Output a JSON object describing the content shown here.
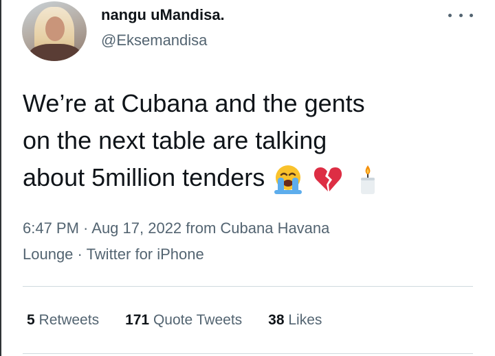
{
  "author": {
    "display_name": "nangu uMandisa.",
    "handle": "@Eksemandisa"
  },
  "tweet": {
    "lines": [
      "We’re at Cubana and the gents",
      "on the next table are talking",
      "about 5million tenders"
    ],
    "emojis": [
      "loudly-crying-face-emoji",
      "broken-heart-emoji",
      "candle-emoji"
    ]
  },
  "meta": {
    "line1": "6:47 PM · Aug 17, 2022 from Cubana Havana",
    "line2": "Lounge · Twitter for iPhone"
  },
  "stats": {
    "retweets_count": "5",
    "retweets_label": "Retweets",
    "quotes_count": "171",
    "quotes_label": "Quote Tweets",
    "likes_count": "38",
    "likes_label": "Likes"
  },
  "colors": {
    "text": "#0f1419",
    "secondary": "#536471",
    "divider": "#cfd9de"
  }
}
